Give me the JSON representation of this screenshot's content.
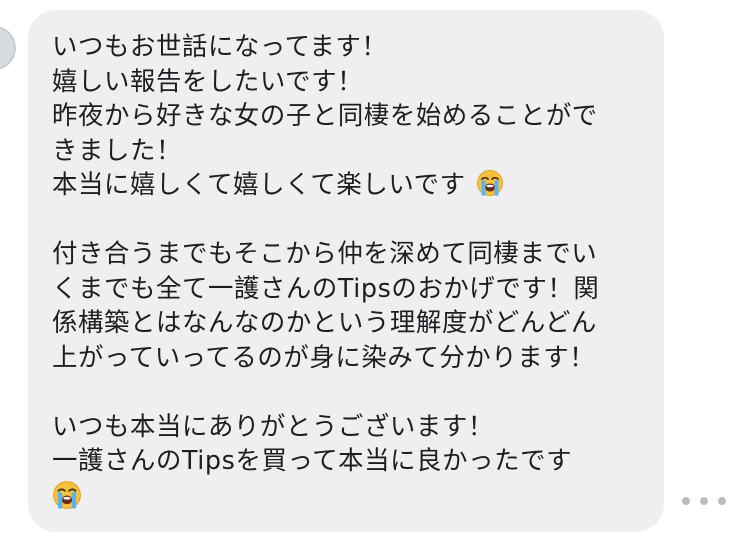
{
  "message": {
    "lines": [
      "いつもお世話になってます！",
      "嬉しい報告をしたいです！",
      "昨夜から好きな女の子と同棲を始めることがで",
      "きました！",
      "本当に嬉しくて嬉しくて楽しいです",
      "",
      "付き合うまでもそこから仲を深めて同棲までい",
      "くまでも全て一護さんのTipsのおかげです！関",
      "係構築とはなんなのかという理解度がどんどん",
      "上がっていってるのが身に染みて分かります！",
      "",
      "いつも本当にありがとうございます！",
      "一護さんのTipsを買って本当に良かったです"
    ],
    "emoji_icon": "loudly-crying-face-emoji"
  },
  "actions": {
    "more_icon": "more-horizontal-icon"
  },
  "colors": {
    "bubble_background": "#efeff1",
    "text": "#1c1e21",
    "more_dots": "#b9bcc1"
  }
}
